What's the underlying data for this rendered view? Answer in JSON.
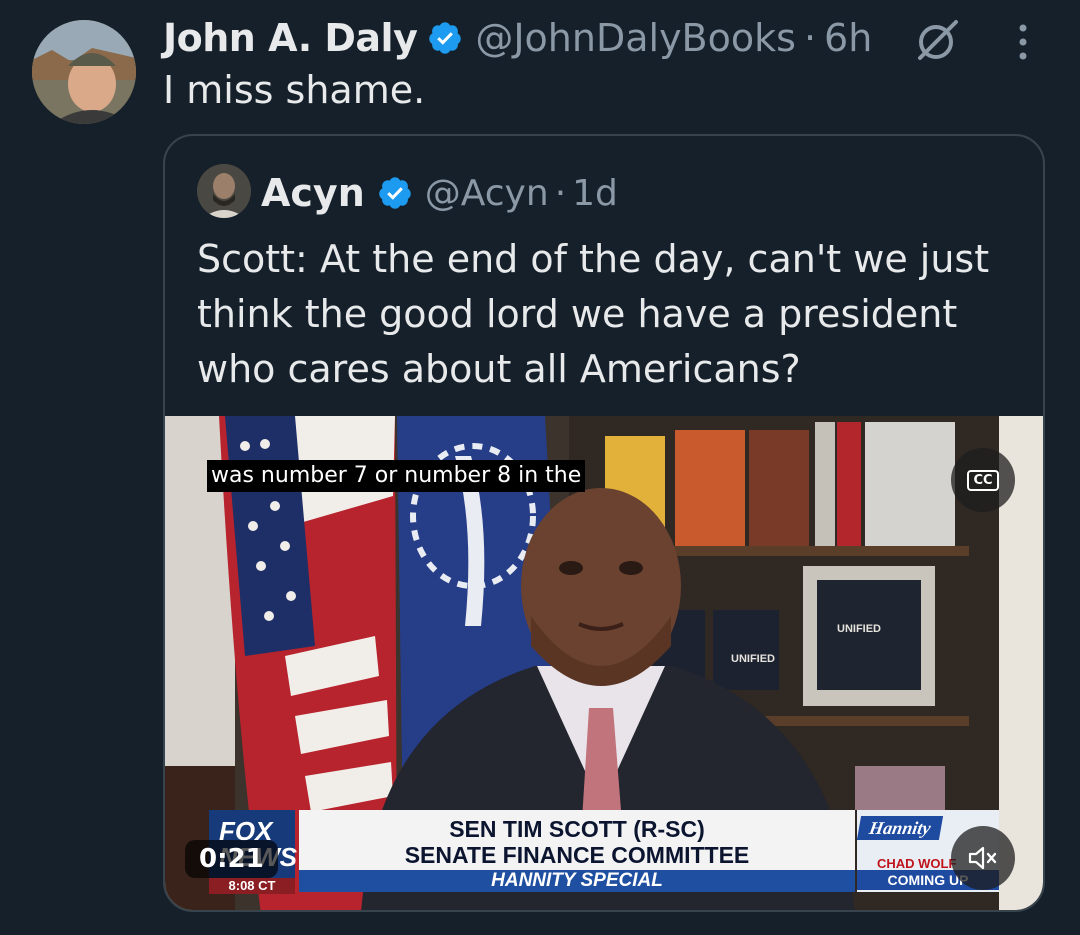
{
  "tweet": {
    "author_name": "John A. Daly",
    "handle": "@JohnDalyBooks",
    "separator": "·",
    "time": "6h",
    "text": "I miss shame."
  },
  "quoted": {
    "author_name": "Acyn",
    "handle": "@Acyn",
    "separator": "·",
    "time": "1d",
    "text": "Scott: At the end of the day, can't we just think the good lord we have a president who cares about all Americans?"
  },
  "video": {
    "caption": "was number 7 or number 8 in the",
    "cc_label": "CC",
    "timer": "0:21",
    "chyron_line1": "SEN TIM SCOTT (R-SC)",
    "chyron_line2": "SENATE FINANCE COMMITTEE",
    "chyron_bar": "HANNITY SPECIAL",
    "network_logo_1": "FOX",
    "network_logo_2": "NEWS",
    "network_time": "8:08 CT",
    "promo_show": "Hannity",
    "promo_line1": "CHAD WOLF",
    "promo_line2": "COMING UP",
    "book_label": "UNIFIED"
  },
  "colors": {
    "background": "#15202b",
    "verified": "#1d9bf0",
    "secondary_text": "#8b98a5",
    "border": "#38444d"
  },
  "icons": [
    "verified-badge-icon",
    "grok-icon",
    "more-options-icon",
    "closed-captions-icon",
    "mute-icon"
  ]
}
